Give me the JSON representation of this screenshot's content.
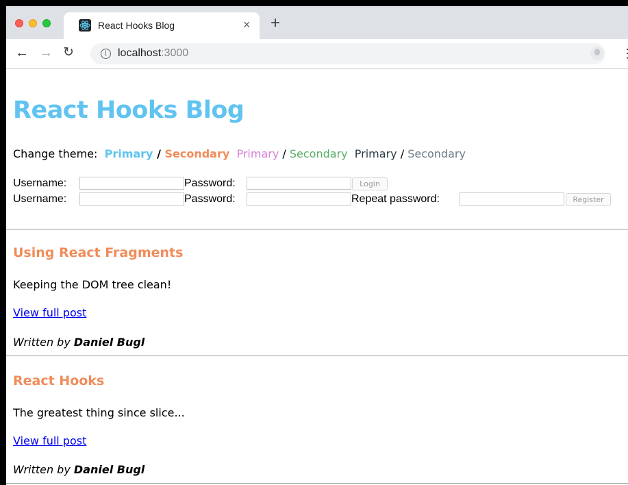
{
  "browser": {
    "tab_title": "React Hooks Blog",
    "tab_close_glyph": "×",
    "new_tab_glyph": "+",
    "url_host": "localhost",
    "url_port": ":3000",
    "icons": [
      "back-icon",
      "forward-icon",
      "reload-icon",
      "info-icon",
      "star-icon",
      "profile-icon",
      "menu-icon",
      "react-favicon-icon"
    ]
  },
  "page": {
    "title": "React Hooks Blog",
    "theme": {
      "label": "Change theme:",
      "options": [
        {
          "primary": "Primary",
          "separator": "/",
          "secondary": "Secondary",
          "primary_color": "#61c3f0",
          "secondary_color": "#f08c5a",
          "bold": true
        },
        {
          "primary": "Primary",
          "separator": "/",
          "secondary": "Secondary",
          "primary_color": "#d67fd4",
          "secondary_color": "#5aad6a",
          "bold": false
        },
        {
          "primary": "Primary",
          "separator": "/",
          "secondary": "Secondary",
          "primary_color": "#2a3a45",
          "secondary_color": "#6c7a86",
          "bold": false
        }
      ]
    },
    "login": {
      "username_label": "Username:",
      "password_label": "Password:",
      "username_value": "",
      "password_value": "",
      "button": "Login"
    },
    "register": {
      "username_label": "Username:",
      "password_label": "Password:",
      "repeat_label": "Repeat password:",
      "username_value": "",
      "password_value": "",
      "repeat_value": "",
      "button": "Register"
    },
    "posts": [
      {
        "title": "Using React Fragments",
        "body": "Keeping the DOM tree clean!",
        "link": "View full post",
        "written_by": "Written by",
        "author": "Daniel Bugl"
      },
      {
        "title": "React Hooks",
        "body": "The greatest thing since slice...",
        "link": "View full post",
        "written_by": "Written by",
        "author": "Daniel Bugl"
      }
    ]
  }
}
